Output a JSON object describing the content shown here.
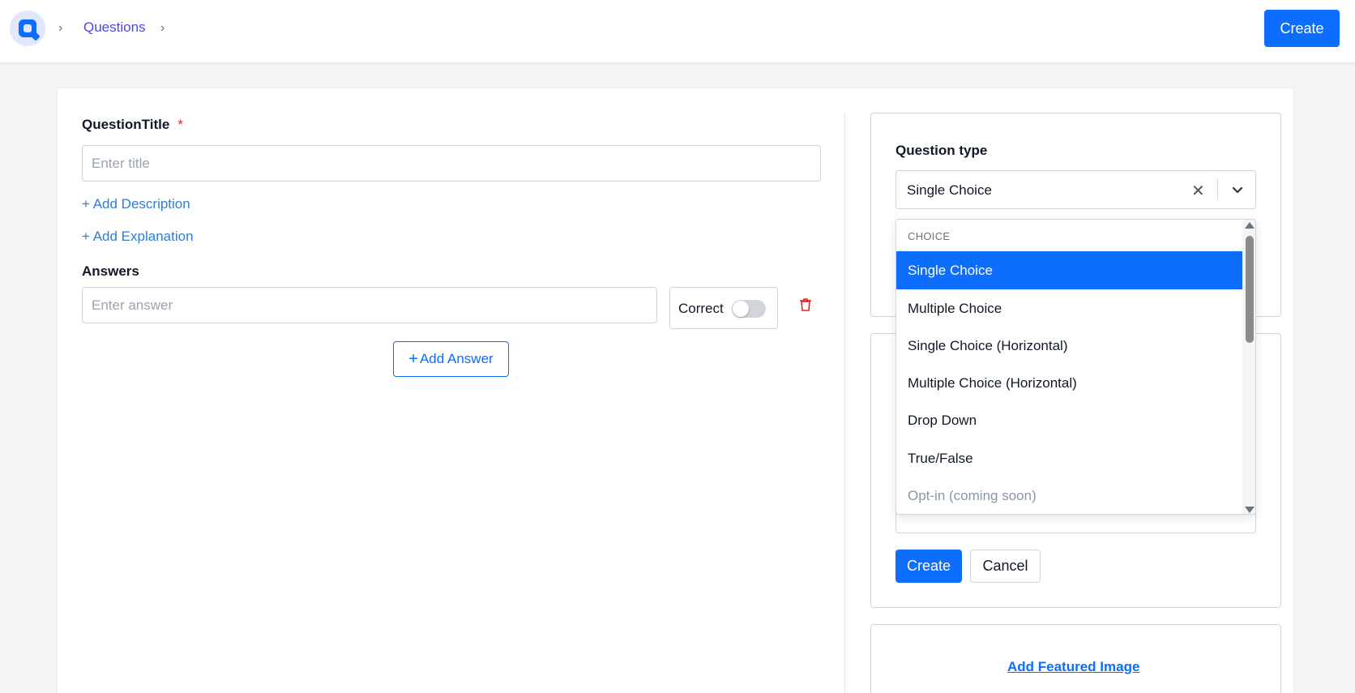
{
  "header": {
    "breadcrumb": {
      "sep1": "›",
      "link": "Questions",
      "sep2": "›"
    },
    "create_label": "Create"
  },
  "form": {
    "title_label": "QuestionTitle",
    "required_mark": "*",
    "title_placeholder": "Enter title",
    "title_value": "",
    "add_description": "+ Add Description",
    "add_explanation": "+ Add Explanation",
    "answers_label": "Answers",
    "answer_placeholder": "Enter answer",
    "answer_value": "",
    "correct_label": "Correct",
    "correct_on": false,
    "add_answer_label": "Add Answer",
    "add_answer_plus": "+"
  },
  "sidebar": {
    "question_type_label": "Question type",
    "selected_value": "Single Choice",
    "clear_glyph": "✕",
    "dropdown": {
      "group_label": "CHOICE",
      "options": [
        {
          "label": "Single Choice",
          "state": "selected"
        },
        {
          "label": "Multiple Choice",
          "state": "normal"
        },
        {
          "label": "Single Choice (Horizontal)",
          "state": "normal"
        },
        {
          "label": "Multiple Choice (Horizontal)",
          "state": "normal"
        },
        {
          "label": "Drop Down",
          "state": "normal"
        },
        {
          "label": "True/False",
          "state": "normal"
        },
        {
          "label": "Opt-in (coming soon)",
          "state": "disabled"
        }
      ]
    },
    "create_label": "Create",
    "cancel_label": "Cancel",
    "featured_image_label": "Add Featured Image"
  },
  "colors": {
    "primary": "#0d6efd",
    "link": "#2b7fd6",
    "danger": "#dc2626",
    "breadcrumb_link": "#4f46e5"
  },
  "icons": [
    "logo-icon",
    "chevron-right-icon",
    "trash-icon",
    "clear-icon",
    "chevron-down-icon",
    "plus-icon"
  ]
}
